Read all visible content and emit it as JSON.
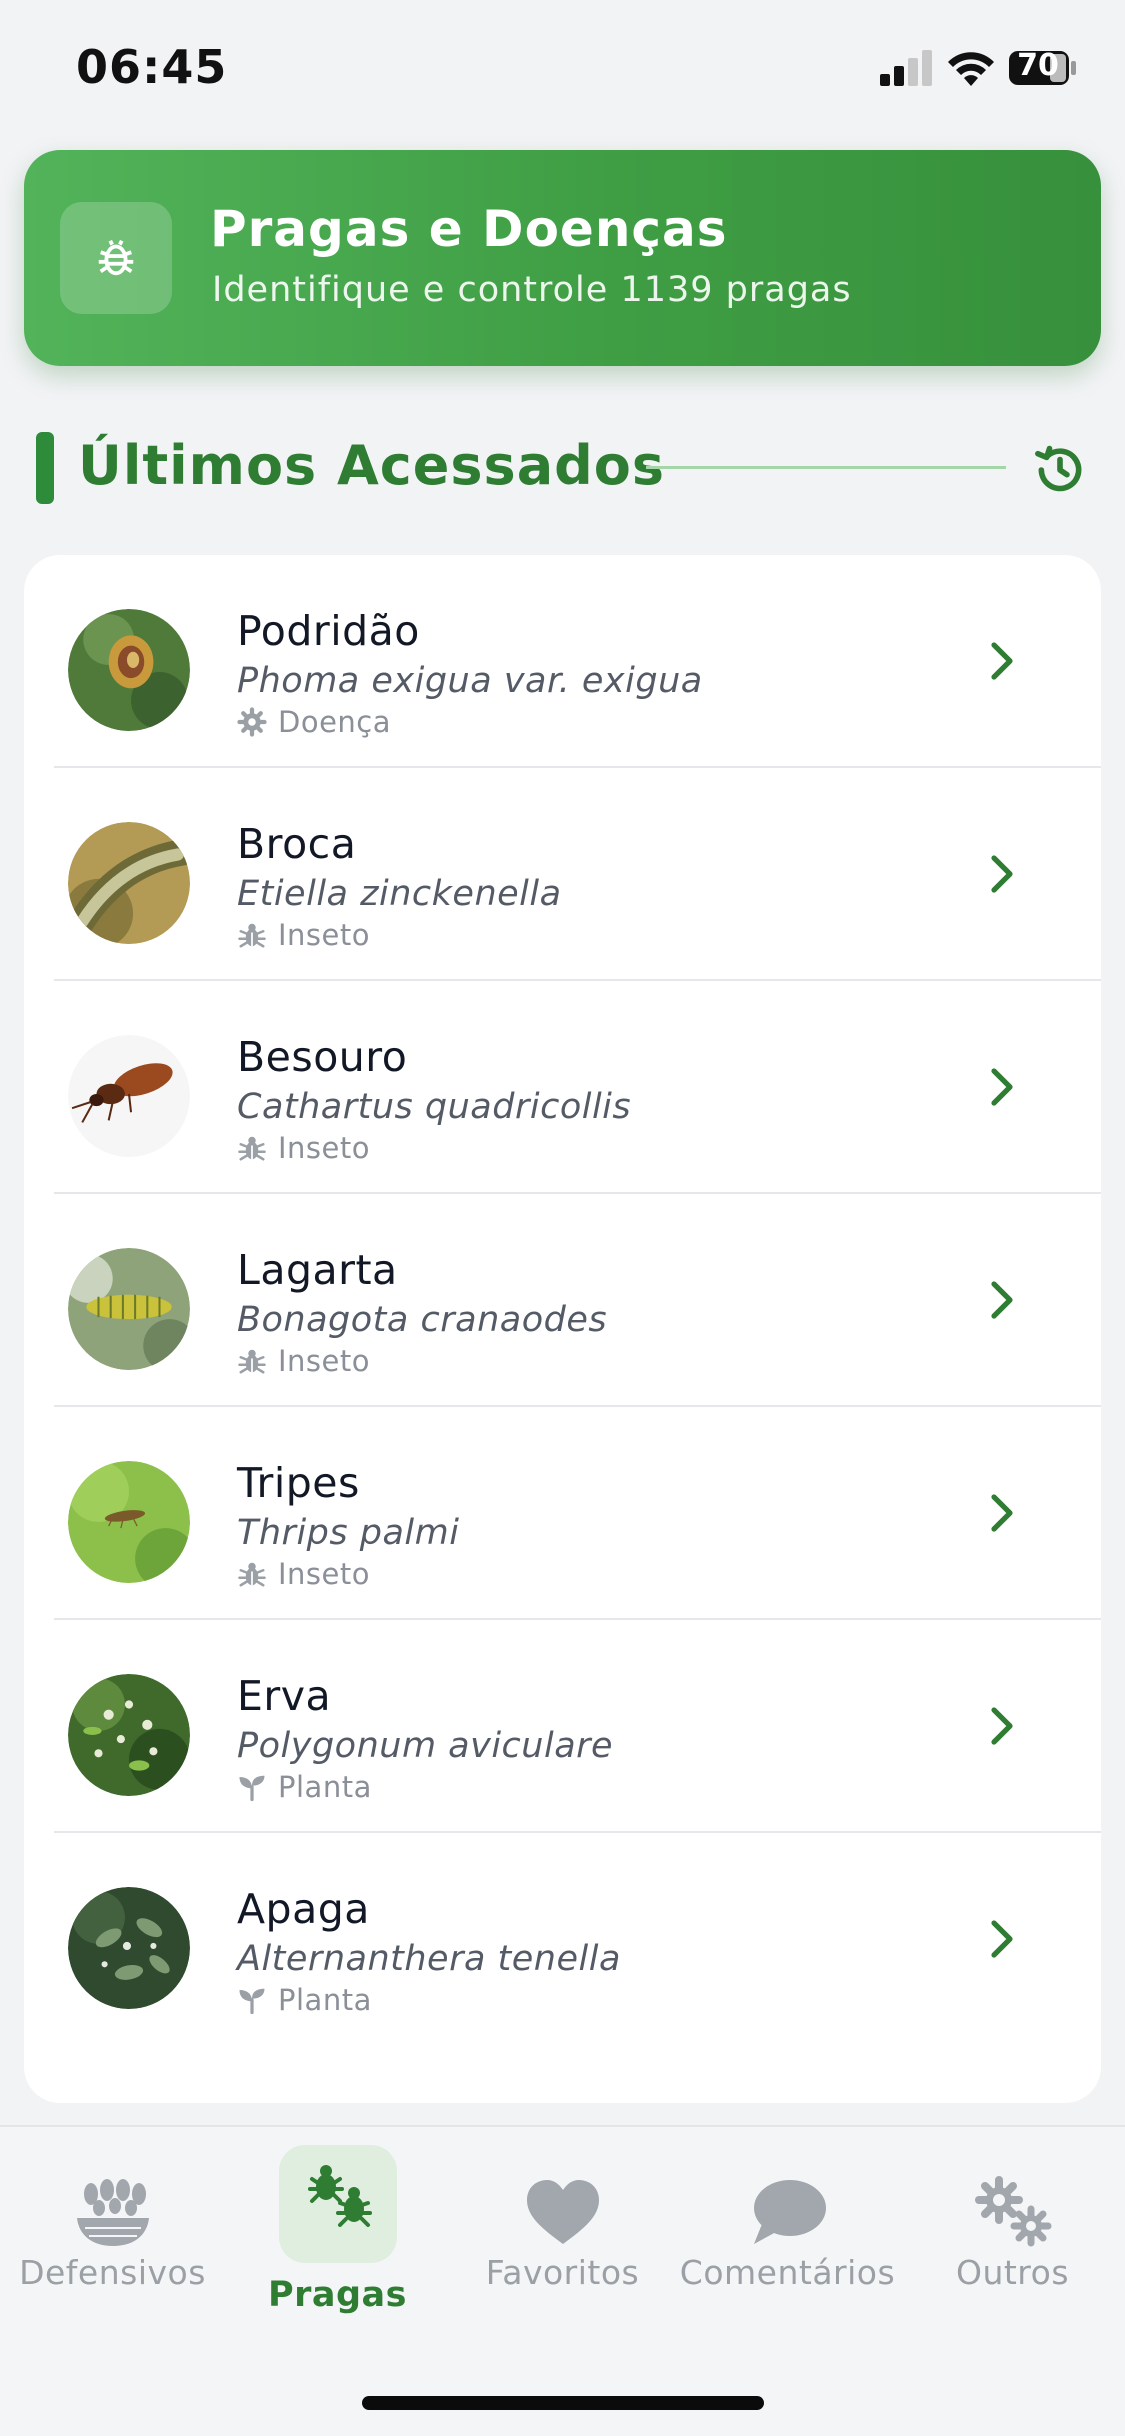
{
  "status_bar": {
    "time": "06:45",
    "battery": "70"
  },
  "header": {
    "title": "Pragas e Doenças",
    "subtitle": "Identifique e controle 1139 pragas",
    "icon": "bug-icon"
  },
  "section": {
    "title": "Últimos Acessados",
    "icon": "history-icon"
  },
  "items": [
    {
      "name": "Podridão",
      "scientific": "Phoma exigua var. exigua",
      "type": "Doença",
      "type_icon": "gear-icon"
    },
    {
      "name": "Broca",
      "scientific": "Etiella zinckenella",
      "type": "Inseto",
      "type_icon": "bug-icon"
    },
    {
      "name": "Besouro",
      "scientific": "Cathartus quadricollis",
      "type": "Inseto",
      "type_icon": "bug-icon"
    },
    {
      "name": "Lagarta",
      "scientific": "Bonagota cranaodes",
      "type": "Inseto",
      "type_icon": "bug-icon"
    },
    {
      "name": "Tripes",
      "scientific": "Thrips palmi",
      "type": "Inseto",
      "type_icon": "bug-icon"
    },
    {
      "name": "Erva",
      "scientific": "Polygonum aviculare",
      "type": "Planta",
      "type_icon": "sprout-icon"
    },
    {
      "name": "Apaga",
      "scientific": "Alternanthera tenella",
      "type": "Planta",
      "type_icon": "sprout-icon"
    }
  ],
  "nav": {
    "items": [
      {
        "label": "Defensivos",
        "icon": "grain-icon"
      },
      {
        "label": "Pragas",
        "icon": "bugs-icon"
      },
      {
        "label": "Favoritos",
        "icon": "heart-icon"
      },
      {
        "label": "Comentários",
        "icon": "chat-icon"
      },
      {
        "label": "Outros",
        "icon": "gears-icon"
      }
    ],
    "active": "Pragas"
  },
  "colors": {
    "accent": "#2e7d32",
    "header_start": "#52b35a",
    "header_end": "#37903c",
    "muted": "#9aa0a6"
  }
}
